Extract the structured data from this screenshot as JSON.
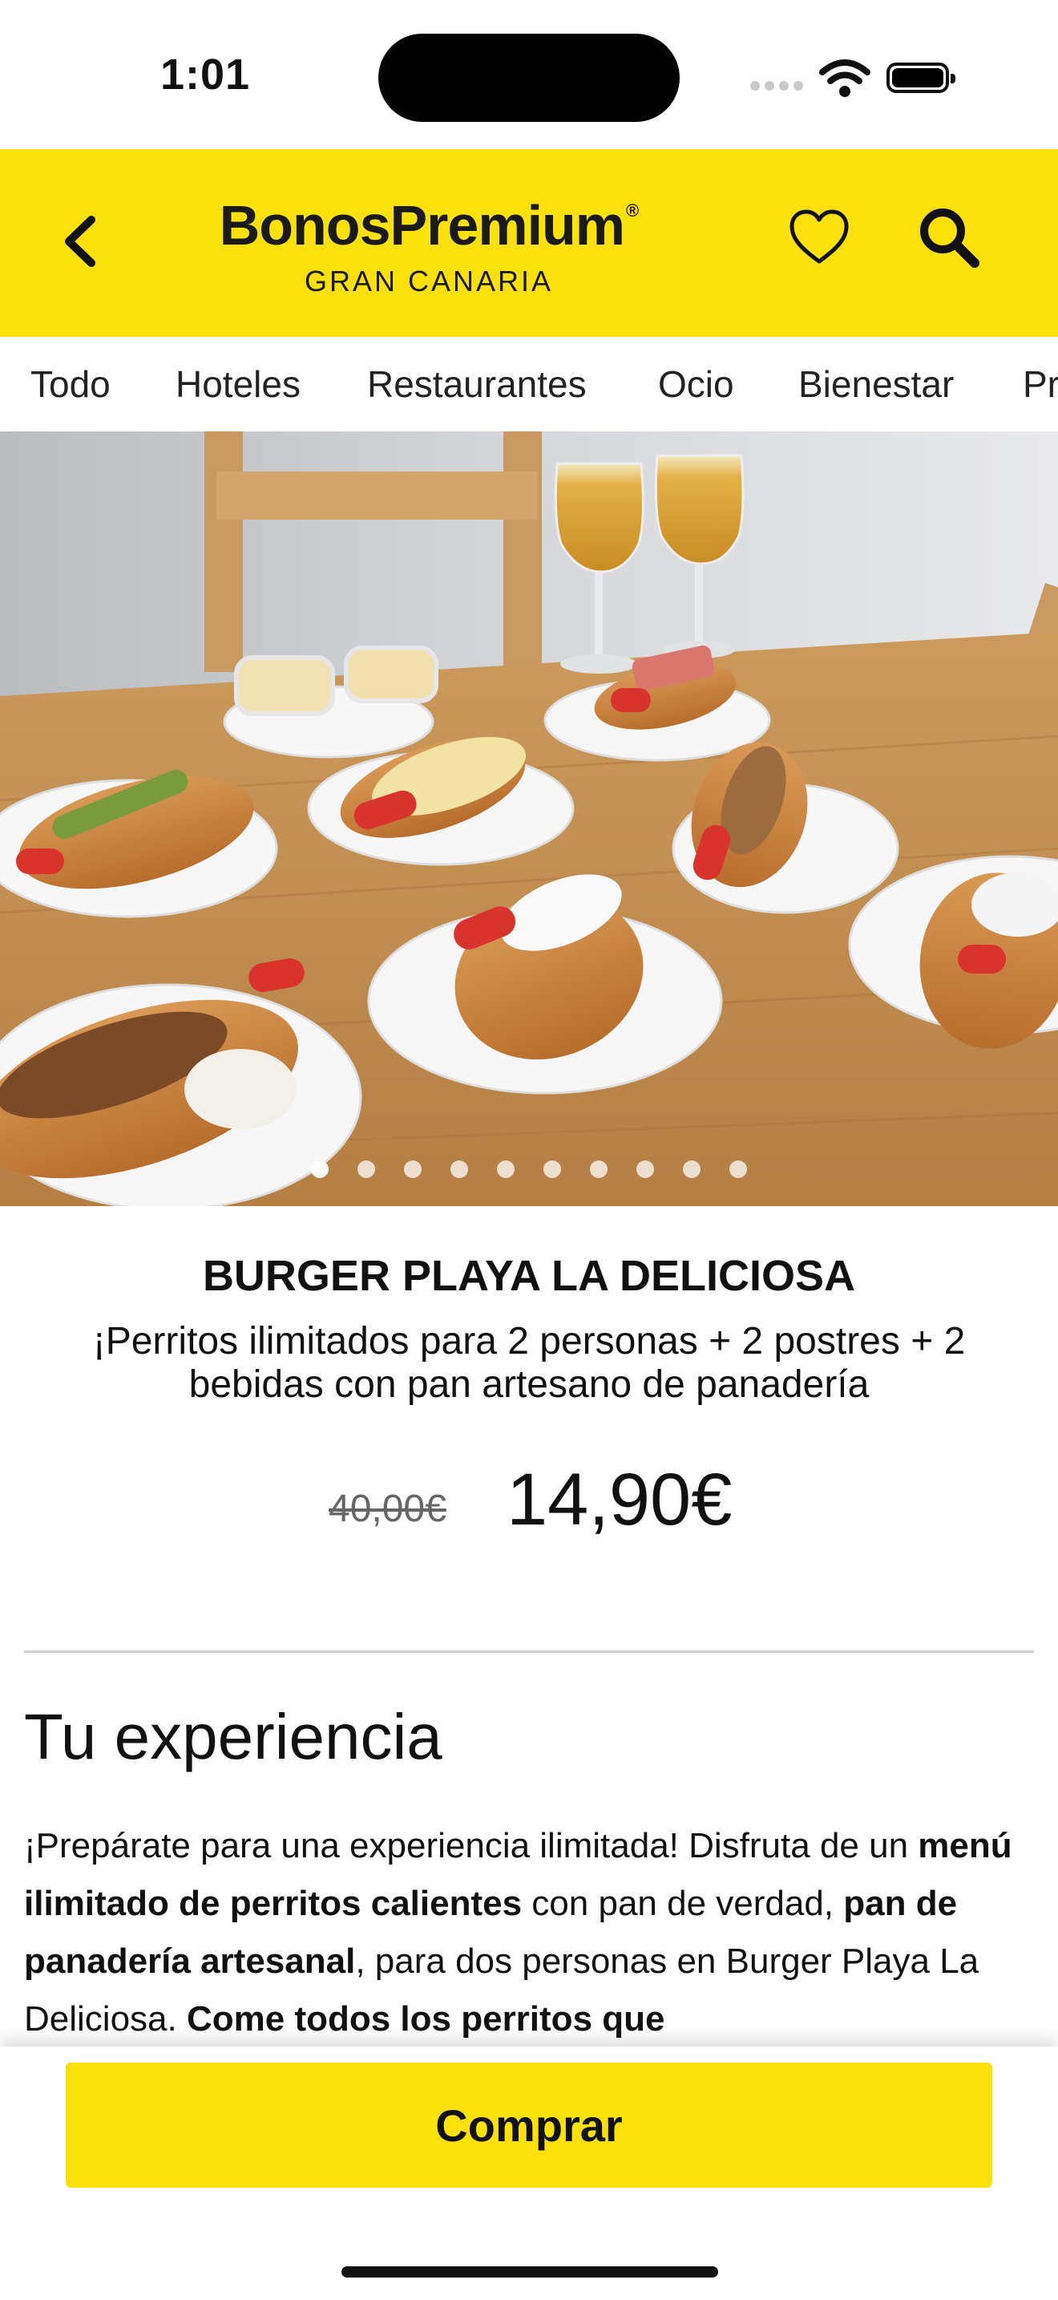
{
  "status_bar": {
    "time": "1:01"
  },
  "header": {
    "logo_main": "BonosPremium",
    "logo_mark": "®",
    "logo_sub": "GRAN CANARIA",
    "back_icon": "chevron-left-icon",
    "favorite_icon": "heart-icon",
    "search_icon": "search-icon",
    "brand_color": "#fbe10c"
  },
  "categories": [
    "Todo",
    "Hoteles",
    "Restaurantes",
    "Ocio",
    "Bienestar",
    "Pr"
  ],
  "carousel": {
    "total": 10,
    "active": 0
  },
  "product": {
    "title": "BURGER PLAYA LA DELICIOSA",
    "subtitle": "¡Perritos ilimitados para 2 personas + 2 postres + 2 bebidas con pan artesano de panadería",
    "old_price": "40,00€",
    "price": "14,90€"
  },
  "experience": {
    "heading": "Tu experiencia",
    "p1": "¡Prepárate para una experiencia ilimitada! Disfruta de un ",
    "b1": "menú ilimitado de perritos calientes",
    "p2": " con pan de verdad, ",
    "b2": "pan de panadería artesanal",
    "p3": ", para dos personas en Burger Playa La Deliciosa. ",
    "b3": "Come todos los perritos que"
  },
  "buy_button": {
    "label": "Comprar"
  }
}
